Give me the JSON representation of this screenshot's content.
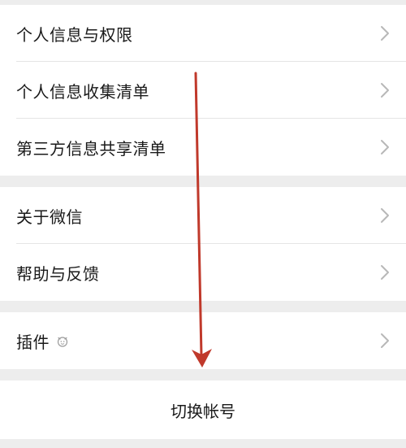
{
  "settings": {
    "privacy_group": [
      {
        "label": "个人信息与权限"
      },
      {
        "label": "个人信息收集清单"
      },
      {
        "label": "第三方信息共享清单"
      }
    ],
    "about_group": [
      {
        "label": "关于微信"
      },
      {
        "label": "帮助与反馈"
      }
    ],
    "plugins": {
      "label": "插件",
      "icon": "plugin-face-icon"
    },
    "switch_account": {
      "label": "切换帐号"
    }
  },
  "annotation": {
    "type": "arrow",
    "direction": "down",
    "color": "#c0392b"
  }
}
